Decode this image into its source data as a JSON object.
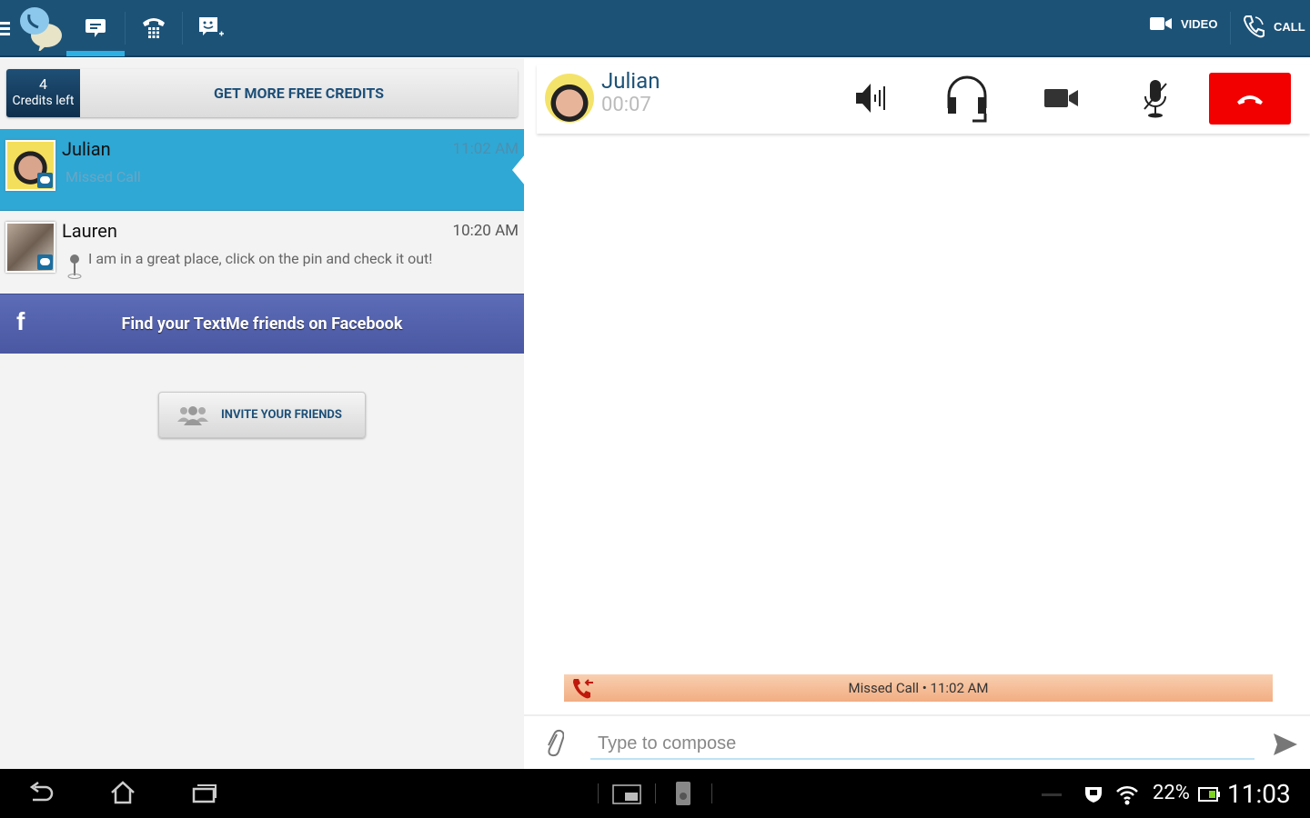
{
  "topbar": {
    "tabs": [
      {
        "icon": "chat-bubble-icon",
        "active": true
      },
      {
        "icon": "dialpad-phone-icon"
      },
      {
        "icon": "add-contact-icon"
      }
    ],
    "video_label": "VIDEO",
    "call_label": "CALL"
  },
  "credits": {
    "count": "4",
    "label": "Credits left",
    "get_more": "GET MORE FREE CREDITS"
  },
  "conversations": [
    {
      "name": "Julian",
      "time": "11:02 AM",
      "preview": "Missed Call",
      "selected": true
    },
    {
      "name": "Lauren",
      "time": "10:20 AM",
      "preview": "I am in a great place, click on the pin and check it out!",
      "has_pin": true
    }
  ],
  "facebook_banner": {
    "icon": "f",
    "text": "Find your TextMe friends on Facebook"
  },
  "invite_button": "INVITE YOUR FRIENDS",
  "call": {
    "name": "Julian",
    "duration": "00:07",
    "controls": [
      "speaker",
      "headset",
      "video",
      "mute",
      "hang-up"
    ],
    "hangup_color": "#f20000"
  },
  "missed_call_notice": "Missed Call • 11:02 AM",
  "compose": {
    "placeholder": "Type to compose"
  },
  "status_bar": {
    "battery": "22%",
    "clock": "11:03"
  },
  "colors": {
    "topbar": "#1d5277",
    "selected_row": "#2fa8d5",
    "facebook": "#5566b0",
    "missed_bar": "#f4b78e"
  }
}
